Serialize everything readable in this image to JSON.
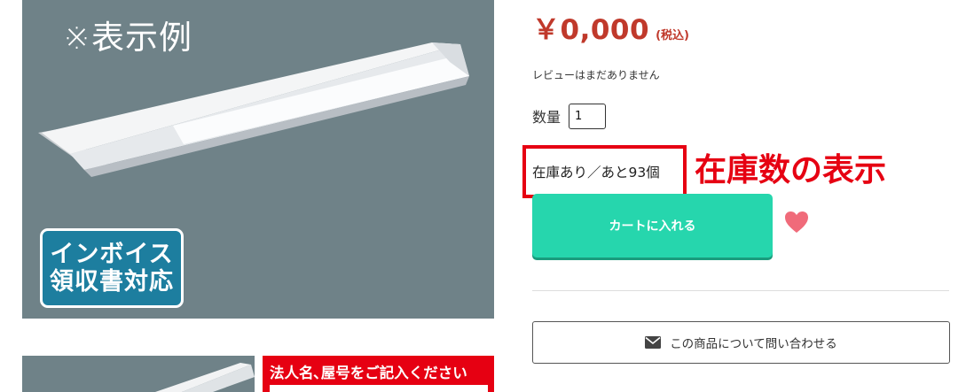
{
  "gallery": {
    "main_image_caption": "※表示例",
    "invoice_badge_lines": [
      "インボイス",
      "領収書対応"
    ],
    "thumbnail_banner_text": "法人名､屋号をご記入ください"
  },
  "product": {
    "price": "￥0,000",
    "tax_label": "(税込)",
    "review_note": "レビューはまだありません",
    "quantity_label": "数量",
    "quantity_value": "1",
    "stock_text": "在庫あり／あと93個",
    "stock_annotation": "在庫数の表示",
    "cart_button_label": "カートに入れる",
    "inquiry_button_label": "この商品について問い合わせる"
  },
  "colors": {
    "price": "#c0392b",
    "annotation": "#e60012",
    "cart_button": "#26d6ad",
    "favorite_heart": "#f06b7a",
    "invoice_badge": "#1d7e9f",
    "image_background": "#6f8288"
  },
  "icons": {
    "favorite": "heart-icon",
    "inquiry": "envelope-icon"
  }
}
